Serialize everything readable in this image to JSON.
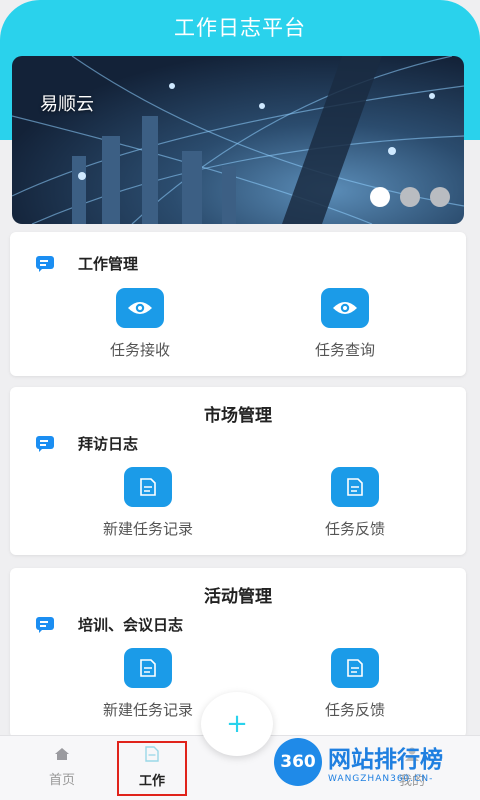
{
  "header": {
    "title": "工作日志平台"
  },
  "banner": {
    "brand": "易顺云",
    "slides": 3,
    "active_slide": 1
  },
  "work_card": {
    "section_label": "工作管理",
    "actions": [
      {
        "label": "任务接收",
        "icon": "eye-icon"
      },
      {
        "label": "任务查询",
        "icon": "eye-icon"
      }
    ]
  },
  "market_card": {
    "title": "市场管理",
    "section_label": "拜访日志",
    "actions": [
      {
        "label": "新建任务记录",
        "icon": "document-icon"
      },
      {
        "label": "任务反馈",
        "icon": "document-icon"
      }
    ]
  },
  "activity_card": {
    "title": "活动管理",
    "section_label": "培训、会议日志",
    "actions": [
      {
        "label": "新建任务记录",
        "icon": "document-icon"
      },
      {
        "label": "任务反馈",
        "icon": "document-icon"
      }
    ]
  },
  "tabbar": {
    "tabs": [
      {
        "label": "首页",
        "icon": "home-icon"
      },
      {
        "label": "工作",
        "icon": "document-icon",
        "active": true
      },
      {
        "label": "我的",
        "icon": "user-icon"
      }
    ],
    "fab_icon": "plus-icon"
  },
  "watermark": {
    "number": "360",
    "title": "网站排行榜",
    "subtitle": "WANGZHAN360.CN-"
  },
  "colors": {
    "accent": "#2ad2ec",
    "icon_blue": "#1b9be8",
    "highlight": "#e0231b"
  }
}
